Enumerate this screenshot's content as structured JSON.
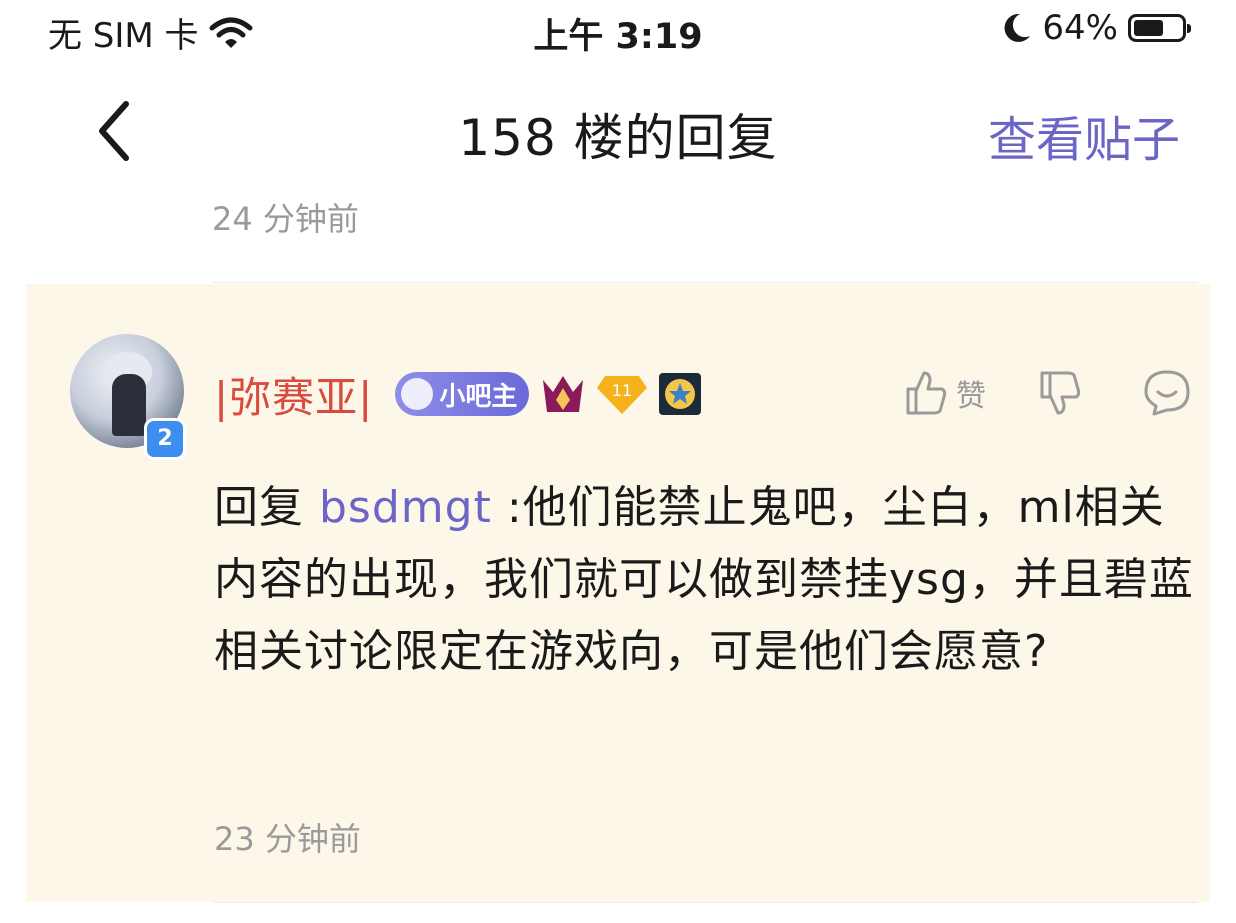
{
  "status_bar": {
    "carrier": "无 SIM 卡",
    "time": "上午 3:19",
    "battery_percent": "64%",
    "battery_level": 0.64,
    "icons": [
      "wifi-icon",
      "moon-icon",
      "battery-icon"
    ]
  },
  "nav": {
    "title": "158 楼的回复",
    "action": "查看贴子",
    "back_icon": "chevron-left-icon"
  },
  "thread": {
    "parent_time": "24 分钟前"
  },
  "reply": {
    "username": "|弥赛亚|",
    "level": "2",
    "admin_badge": "小吧主",
    "gem_level": "11",
    "like_label": "赞",
    "prefix": "回复 ",
    "mention": "bsdmgt",
    "content": " :他们能禁止鬼吧，尘白，ml相关内容的出现，我们就可以做到禁挂ysg，并且碧蓝相关讨论限定在游戏向，可是他们会愿意?",
    "time": "23 分钟前"
  },
  "colors": {
    "accent": "#6b66c6",
    "username": "#d94b3f",
    "highlight_bg": "#fdf7ea",
    "muted": "#9a9a9a"
  }
}
